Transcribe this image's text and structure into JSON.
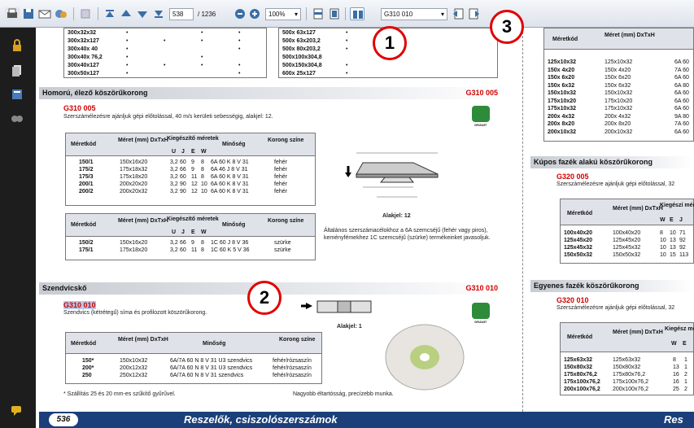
{
  "toolbar": {
    "page_current": "538",
    "page_total": "/ 1236",
    "zoom": "100%",
    "search": "G310 010"
  },
  "circles": [
    "1",
    "2",
    "3"
  ],
  "top_table_left": {
    "rows": [
      [
        "300x32x32",
        "•",
        "",
        "•",
        "•"
      ],
      [
        "300x32x127",
        "•",
        "•",
        "•",
        "•"
      ],
      [
        "300x40x 40",
        "•",
        "",
        "",
        "•"
      ],
      [
        "300x40x 76,2",
        "•",
        "",
        "•",
        ""
      ],
      [
        "300x40x127",
        "•",
        "•",
        "•",
        "•"
      ],
      [
        "300x50x127",
        "•",
        "",
        "",
        "•"
      ]
    ]
  },
  "top_table_mid": {
    "rows": [
      [
        "500x 63x127",
        "•"
      ],
      [
        "500x 63x203,2",
        "•"
      ],
      [
        "500x 80x203,2",
        "•"
      ],
      [
        "500x100x304,8",
        ""
      ],
      [
        "500x150x304,8",
        "•"
      ],
      [
        "600x 25x127",
        "•"
      ]
    ]
  },
  "sec1": {
    "title": "Homorú, élező köszörűkorong",
    "code": "G310 005",
    "subcode": "G310 005",
    "desc": "Szerszámélezésre ajánljuk gépi előtolással, 40 m/s kerületi sebességig, alakjel: 12.",
    "headers": [
      "Méretkód",
      "Méret (mm) DxTxH",
      "Kiegészítő méretek",
      "U",
      "J",
      "E",
      "W",
      "Minőség",
      "Korong színe"
    ],
    "rows": [
      [
        "150/1",
        "150x16x20",
        "3,2",
        "60",
        "9",
        "8",
        "6A 60 K 8 V 31",
        "fehér"
      ],
      [
        "175/2",
        "175x18x32",
        "3,2",
        "66",
        "9",
        "8",
        "6A 46 J 8 V 31",
        "fehér"
      ],
      [
        "175/3",
        "175x18x20",
        "3,2",
        "60",
        "11",
        "8",
        "6A 60 K 8 V 31",
        "fehér"
      ],
      [
        "200/1",
        "200x20x20",
        "3,2",
        "90",
        "12",
        "10",
        "6A 60 K 8 V 31",
        "fehér"
      ],
      [
        "200/2",
        "200x20x32",
        "3,2",
        "90",
        "12",
        "10",
        "6A 60 K 8 V 31",
        "fehér"
      ]
    ],
    "rows2": [
      [
        "150/2",
        "150x16x20",
        "3,2",
        "66",
        "9",
        "8",
        "1C 60 J 8 V 36",
        "szürke"
      ],
      [
        "175/1",
        "175x18x20",
        "3,2",
        "60",
        "11",
        "8",
        "1C 60 K 5 V 36",
        "szürke"
      ]
    ],
    "alakjel": "Alakjel: 12",
    "note": "Általános szerszámacélokhoz a 6A szemcséjű (fehér vagy piros), keményfémekhez 1C szemcséjű (szürke) termékeinket javasoljuk."
  },
  "sec2": {
    "title": "Szendvicskő",
    "code": "G310 010",
    "subcode": "G310 010",
    "desc": "Szendvics (kétrétegű) síma és profilozott köszörűkorong.",
    "headers": [
      "Méretkód",
      "Méret (mm) DxTxH",
      "Minőség",
      "Korong színe"
    ],
    "rows": [
      [
        "150*",
        "150x10x32",
        "6A/7A 60 N 8 V 31 U3 szendvics",
        "fehér/rózsaszín"
      ],
      [
        "200*",
        "200x12x32",
        "6A/7A 60 N 8 V 31 U3 szendvics",
        "fehér/rózsaszín"
      ],
      [
        "250",
        "250x12x32",
        "6A/7A 60 N 8 V 31 szendvics",
        "fehér/rózsaszín"
      ]
    ],
    "alakjel": "Alakjel: 1",
    "footnote": "* Szállítás 25 és 20 mm-es szűkítő gyűrűvel.",
    "footnote2": "Nagyobb éltartósság, precízebb munka."
  },
  "right": {
    "headers": [
      "Méretkód",
      "Méret (mm) DxTxH"
    ],
    "rows": [
      [
        "125x10x32",
        "125x10x32",
        "6A 60"
      ],
      [
        "150x 4x20",
        "150x 4x20",
        "7A 60"
      ],
      [
        "150x 6x20",
        "150x 6x20",
        "6A 60"
      ],
      [
        "150x 6x32",
        "150x 6x32",
        "6A 80"
      ],
      [
        "150x10x32",
        "150x10x32",
        "6A 60"
      ],
      [
        "175x10x20",
        "175x10x20",
        "6A 60"
      ],
      [
        "175x10x32",
        "175x10x32",
        "6A 60"
      ],
      [
        "200x 4x32",
        "200x 4x32",
        "9A 80"
      ],
      [
        "200x 8x20",
        "200x 8x20",
        "7A 60"
      ],
      [
        "200x10x32",
        "200x10x32",
        "6A 60"
      ]
    ],
    "kupos_title": "Kúpos fazék alakú köszörűkorong",
    "kupos_code": "G320 005",
    "kupos_desc": "Szerszámélezésre ajánljuk gépi előtolással, 32",
    "kupos_headers": [
      "Méretkód",
      "Méret (mm) DxTxH",
      "Kiegészí méreté",
      "W",
      "E",
      "J"
    ],
    "kupos_rows": [
      [
        "100x40x20",
        "100x40x20",
        "8",
        "10",
        "71"
      ],
      [
        "125x45x20",
        "125x45x20",
        "10",
        "13",
        "92"
      ],
      [
        "125x45x32",
        "125x45x32",
        "10",
        "13",
        "92"
      ],
      [
        "150x50x32",
        "150x50x32",
        "10",
        "15",
        "113"
      ]
    ],
    "egyenes_title": "Egyenes fazék köszörűkorong",
    "egyenes_code": "G320 010",
    "egyenes_desc": "Szerszámélezésre ajánljuk gépi előtolással, 32",
    "egyenes_headers": [
      "Méretkód",
      "Méret (mm) DxTxH",
      "Kiegész méret",
      "W",
      "E"
    ],
    "egyenes_rows": [
      [
        "125x63x32",
        "125x63x32",
        "8",
        "1"
      ],
      [
        "150x80x32",
        "150x80x32",
        "13",
        "1"
      ],
      [
        "175x80x76,2",
        "175x80x76,2",
        "16",
        "2"
      ],
      [
        "175x100x76,2",
        "175x100x76,2",
        "16",
        "1"
      ],
      [
        "200x100x76,2",
        "200x100x76,2",
        "25",
        "2"
      ]
    ]
  },
  "footer": {
    "page_num": "536",
    "title": "Reszelők, csiszolószerszámok",
    "title_right": "Res"
  },
  "granit": "GRANIT"
}
